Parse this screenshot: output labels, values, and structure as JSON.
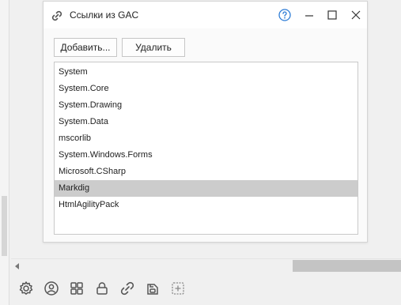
{
  "dialog": {
    "title": "Ссылки из GAC",
    "title_icon": "link-icon",
    "help_icon": "help-circle-icon",
    "help_color": "#2e7dd6",
    "window_controls": [
      "minimize",
      "maximize",
      "close"
    ]
  },
  "toolbar": {
    "add_label": "Добавить...",
    "delete_label": "Удалить"
  },
  "list": {
    "items": [
      "System",
      "System.Core",
      "System.Drawing",
      "System.Data",
      "mscorlib",
      "System.Windows.Forms",
      "Microsoft.CSharp",
      "Markdig",
      "HtmlAgilityPack"
    ],
    "selected": "Markdig"
  },
  "bottom_toolbar": {
    "icons": [
      "gear-icon",
      "user-icon",
      "grid-icon",
      "lock-icon",
      "link-icon",
      "database-icon",
      "add-box-icon"
    ]
  }
}
